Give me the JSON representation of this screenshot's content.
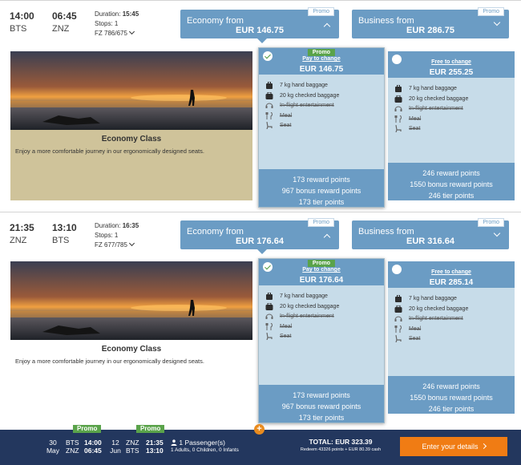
{
  "flights": [
    {
      "depart_time": "14:00",
      "depart_code": "BTS",
      "arrive_time": "06:45",
      "arrive_code": "ZNZ",
      "duration_label": "Duration:",
      "duration": "15:45",
      "stops": "Stops: 1",
      "flight_numbers": "FZ 786/675",
      "economy_tab": {
        "label": "Economy from",
        "price": "EUR 146.75",
        "promo": "Promo"
      },
      "business_tab": {
        "label": "Business from",
        "price": "EUR 286.75",
        "promo": "Promo"
      },
      "class_card": {
        "title": "Economy Class",
        "desc": "Enjoy a more comfortable journey in our ergonomically designed seats."
      },
      "option_a": {
        "promo": "Promo",
        "change": "Pay to change",
        "price": "EUR 146.75",
        "pts1": "173 reward points",
        "pts2": "967 bonus reward points",
        "pts3": "173 tier points"
      },
      "option_b": {
        "change": "Free to change",
        "price": "EUR 255.25",
        "pts1": "246 reward points",
        "pts2": "1550 bonus reward points",
        "pts3": "246 tier points"
      }
    },
    {
      "depart_time": "21:35",
      "depart_code": "ZNZ",
      "arrive_time": "13:10",
      "arrive_code": "BTS",
      "duration_label": "Duration:",
      "duration": "16:35",
      "stops": "Stops: 1",
      "flight_numbers": "FZ 677/785",
      "economy_tab": {
        "label": "Economy from",
        "price": "EUR 176.64",
        "promo": "Promo"
      },
      "business_tab": {
        "label": "Business from",
        "price": "EUR 316.64",
        "promo": "Promo"
      },
      "class_card": {
        "title": "Economy Class",
        "desc": "Enjoy a more comfortable journey in our ergonomically designed seats."
      },
      "option_a": {
        "promo": "Promo",
        "change": "Pay to change",
        "price": "EUR 176.64",
        "pts1": "173 reward points",
        "pts2": "967 bonus reward points",
        "pts3": "173 tier points"
      },
      "option_b": {
        "change": "Free to change",
        "price": "EUR 285.14",
        "pts1": "246 reward points",
        "pts2": "1550 bonus reward points",
        "pts3": "246 tier points"
      }
    }
  ],
  "features": [
    {
      "icon": "hand-baggage-icon",
      "label": "7 kg hand baggage",
      "included": true
    },
    {
      "icon": "checked-baggage-icon",
      "label": "20 kg checked baggage",
      "included": true
    },
    {
      "icon": "entertainment-icon",
      "label": "In-flight entertainment",
      "included": false
    },
    {
      "icon": "meal-icon",
      "label": "Meal",
      "included": false
    },
    {
      "icon": "seat-icon",
      "label": "Seat",
      "included": false
    }
  ],
  "summary": {
    "promo1": "Promo",
    "promo2": "Promo",
    "out_day": "30",
    "out_month": "May",
    "out_from": "BTS",
    "out_to": "ZNZ",
    "out_dep": "14:00",
    "out_arr": "06:45",
    "ret_day": "12",
    "ret_month": "Jun",
    "ret_from": "ZNZ",
    "ret_to": "BTS",
    "ret_dep": "21:35",
    "ret_arr": "13:10",
    "passengers": "1 Passenger(s)",
    "passenger_detail": "1 Adults, 0 Children, 0 Infants",
    "total": "TOTAL: EUR 323.39",
    "redeem": "Redeem 43326 points + EUR 80.39 cash",
    "cta": "Enter your details"
  },
  "colors": {
    "accent": "#6b9cc4",
    "promo_green": "#5aa34a",
    "cta_orange": "#f07c14",
    "bar": "#23375e",
    "card_sand": "#cfc39a"
  }
}
